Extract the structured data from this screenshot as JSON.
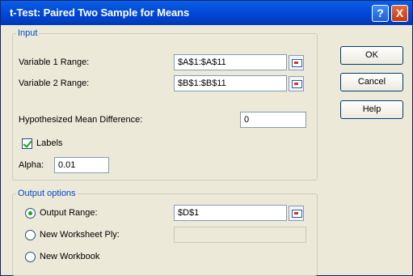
{
  "window": {
    "title": "t-Test: Paired Two Sample for Means",
    "help_glyph": "?",
    "close_glyph": "X"
  },
  "input": {
    "legend": "Input",
    "var1_label": "Variable 1 Range:",
    "var1_value": "$A$1:$A$11",
    "var2_label": "Variable 2 Range:",
    "var2_value": "$B$1:$B$11",
    "hyp_label": "Hypothesized Mean Difference:",
    "hyp_value": "0",
    "labels_label": "Labels",
    "alpha_label": "Alpha:",
    "alpha_value": "0.01"
  },
  "output": {
    "legend": "Output options",
    "range_label": "Output Range:",
    "range_value": "$D$1",
    "new_ply_label": "New Worksheet Ply:",
    "new_ply_value": "",
    "new_workbook_label": "New Workbook"
  },
  "buttons": {
    "ok": "OK",
    "cancel": "Cancel",
    "help": "Help"
  }
}
